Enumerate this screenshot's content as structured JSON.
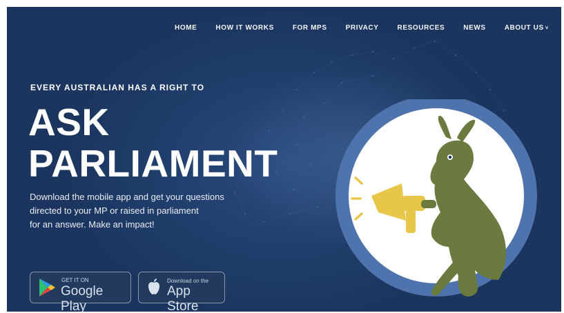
{
  "nav": {
    "items": [
      "HOME",
      "HOW IT WORKS",
      "FOR MPS",
      "PRIVACY",
      "RESOURCES",
      "NEWS",
      "ABOUT US"
    ],
    "dropdown_marker": "˅"
  },
  "hero": {
    "eyebrow": "EVERY AUSTRALIAN HAS A RIGHT TO",
    "title_line1": "ASK",
    "title_line2": "PARLIAMENT",
    "description_line1": "Download the mobile app and get your questions",
    "description_line2": "directed to your MP or raised in parliament",
    "description_line3": "for an answer. Make an impact!"
  },
  "store_buttons": {
    "google": {
      "small": "GET IT ON",
      "big": "Google Play",
      "icon": "google-play-icon"
    },
    "apple": {
      "small": "Download on the",
      "big": "App Store",
      "icon": "apple-icon"
    }
  },
  "logo": {
    "icon": "kangaroo-megaphone-icon"
  },
  "colors": {
    "background": "#1e3a66",
    "logo_ring": "#4f73ad",
    "kangaroo": "#6b7a3e",
    "megaphone": "#e8c64a"
  }
}
